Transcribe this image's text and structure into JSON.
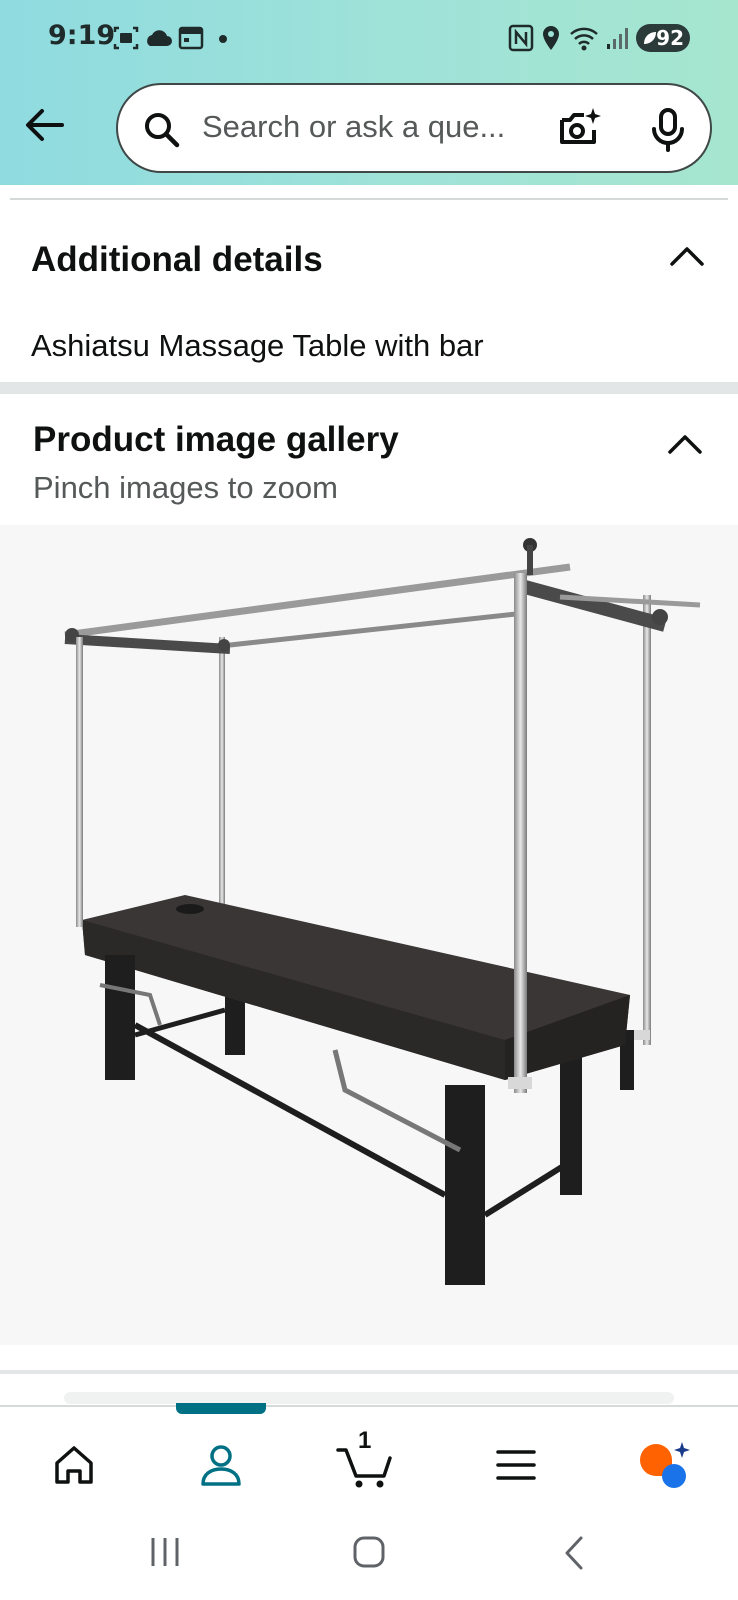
{
  "status": {
    "time": "9:19",
    "battery": "92"
  },
  "search": {
    "placeholder": "Search or ask a que..."
  },
  "additional_details": {
    "title": "Additional details",
    "text": "Ashiatsu Massage Table with bar"
  },
  "gallery": {
    "title": "Product image gallery",
    "subtitle": "Pinch images to zoom"
  },
  "bottom_nav": {
    "cart_count": "1"
  },
  "colors": {
    "accent": "#007185",
    "header_start": "#8fdbe0",
    "header_end": "#a6e6cf"
  },
  "icons": [
    "back-arrow-icon",
    "search-icon",
    "camera-icon",
    "mic-icon",
    "chevron-up-icon",
    "home-icon",
    "account-icon",
    "cart-icon",
    "menu-icon",
    "rufus-icon"
  ]
}
